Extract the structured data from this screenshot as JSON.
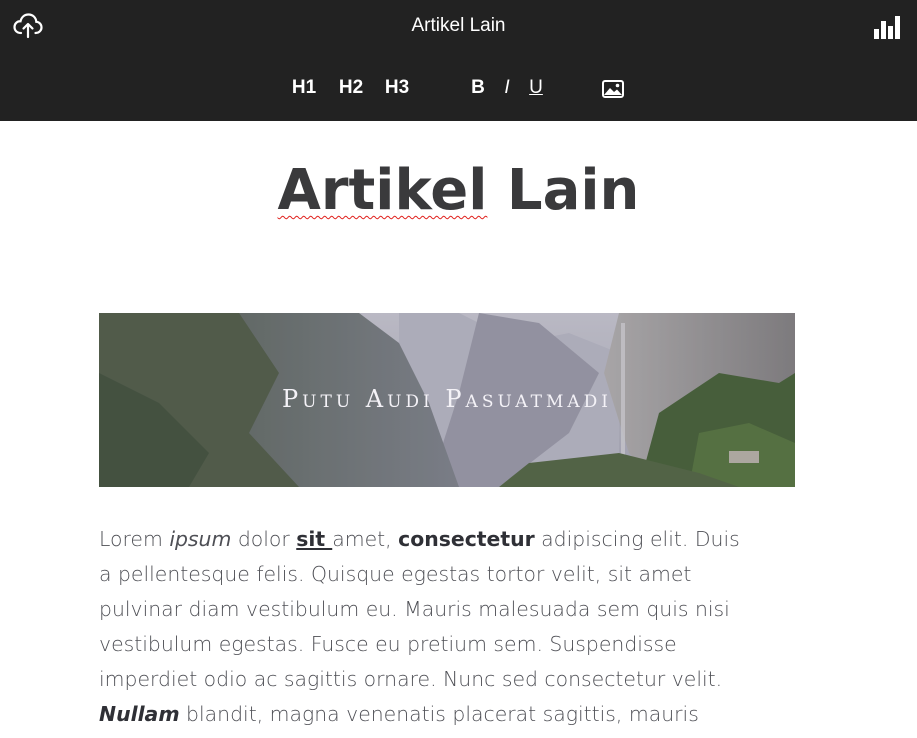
{
  "header": {
    "title": "Artikel Lain",
    "upload_icon": "cloud-upload-icon",
    "stats_icon": "bar-chart-icon"
  },
  "toolbar": {
    "h1": "H1",
    "h2": "H2",
    "h3": "H3",
    "bold": "B",
    "italic": "I",
    "underline": "U",
    "image_icon": "image-icon"
  },
  "article": {
    "title_word1": "Artikel",
    "title_word2": "Lain",
    "banner_caption": "Putu Audi Pasuatmadi",
    "body": {
      "l1_a": "Lorem ",
      "l1_b": "ipsum",
      "l1_c": " dolor ",
      "l1_d": "sit ",
      "l1_e": "amet, ",
      "l1_f": "consectetur",
      "l1_g": " adipiscing elit. Duis",
      "l2": "a pellentesque felis. Quisque egestas tortor velit, sit amet",
      "l3": "pulvinar diam vestibulum eu. Mauris malesuada sem quis nisi",
      "l4": "vestibulum egestas. Fusce eu pretium sem. Suspendisse",
      "l5": "imperdiet odio ac sagittis ornare. Nunc sed consectetur velit.",
      "l6_a": "Nullam",
      "l6_b": " blandit, magna venenatis placerat sagittis, mauris"
    }
  },
  "colors": {
    "topbar": "#222222",
    "title_text": "#3a3a3c",
    "body_text": "#4e4f55",
    "spellcheck": "#e0201c"
  }
}
